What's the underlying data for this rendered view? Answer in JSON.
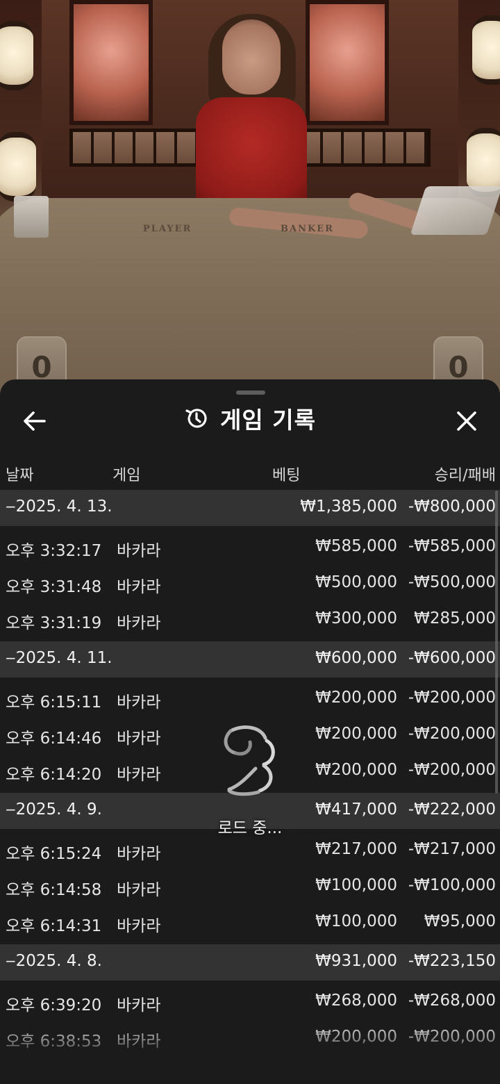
{
  "video": {
    "table_labels": [
      "PLAYER",
      "BANKER"
    ],
    "player_score": "0",
    "banker_score": "0"
  },
  "sheet": {
    "title": "게임 기록",
    "back_icon": "arrow-left-icon",
    "history_icon": "history-clock-icon",
    "close_icon": "close-x-icon",
    "columns": {
      "date": "날짜",
      "game": "게임",
      "bet": "베팅",
      "result": "승리/패배"
    },
    "groups": [
      {
        "date": "‒2025. 4. 13.",
        "total_bet": "₩1,385,000",
        "total_result": "-₩800,000",
        "rows": [
          {
            "time": "오후 3:32:17",
            "game": "바카라",
            "bet": "₩585,000",
            "result": "-₩585,000"
          },
          {
            "time": "오후 3:31:48",
            "game": "바카라",
            "bet": "₩500,000",
            "result": "-₩500,000"
          },
          {
            "time": "오후 3:31:19",
            "game": "바카라",
            "bet": "₩300,000",
            "result": "₩285,000"
          }
        ]
      },
      {
        "date": "‒2025. 4. 11.",
        "total_bet": "₩600,000",
        "total_result": "-₩600,000",
        "rows": [
          {
            "time": "오후 6:15:11",
            "game": "바카라",
            "bet": "₩200,000",
            "result": "-₩200,000"
          },
          {
            "time": "오후 6:14:46",
            "game": "바카라",
            "bet": "₩200,000",
            "result": "-₩200,000"
          },
          {
            "time": "오후 6:14:20",
            "game": "바카라",
            "bet": "₩200,000",
            "result": "-₩200,000"
          }
        ]
      },
      {
        "date": "‒2025. 4. 9.",
        "total_bet": "₩417,000",
        "total_result": "-₩222,000",
        "rows": [
          {
            "time": "오후 6:15:24",
            "game": "바카라",
            "bet": "₩217,000",
            "result": "-₩217,000"
          },
          {
            "time": "오후 6:14:58",
            "game": "바카라",
            "bet": "₩100,000",
            "result": "-₩100,000"
          },
          {
            "time": "오후 6:14:31",
            "game": "바카라",
            "bet": "₩100,000",
            "result": "₩95,000"
          }
        ]
      },
      {
        "date": "‒2025. 4. 8.",
        "total_bet": "₩931,000",
        "total_result": "-₩223,150",
        "rows": [
          {
            "time": "오후 6:39:20",
            "game": "바카라",
            "bet": "₩268,000",
            "result": "-₩268,000"
          },
          {
            "time": "오후 6:38:53",
            "game": "바카라",
            "bet": "₩200,000",
            "result": "-₩200,000"
          }
        ]
      }
    ]
  },
  "loader": {
    "label": "로드 중...",
    "icon": "loading-spinner-icon"
  }
}
